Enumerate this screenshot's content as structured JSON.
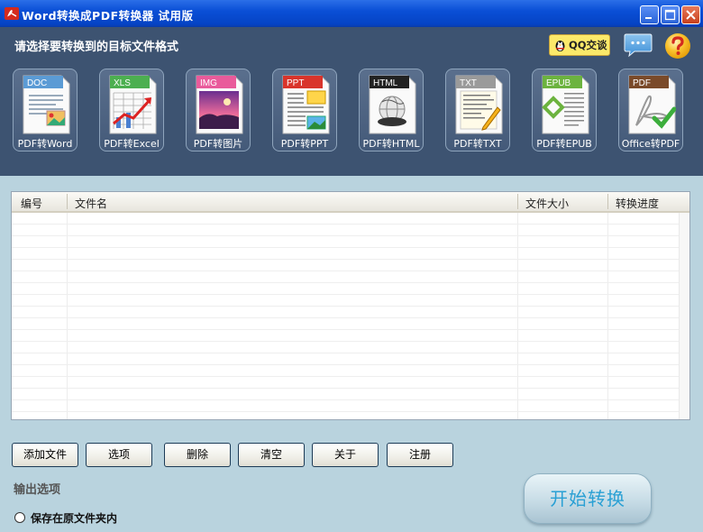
{
  "window": {
    "title": "Word转换成PDF转换器 试用版"
  },
  "header": {
    "prompt": "请选择要转换到的目标文件格式",
    "qq_label": "QQ交谈"
  },
  "formats": [
    {
      "badge": "DOC",
      "label": "PDF转Word",
      "color": "#5b9bd5"
    },
    {
      "badge": "XLS",
      "label": "PDF转Excel",
      "color": "#4caf50"
    },
    {
      "badge": "IMG",
      "label": "PDF转图片",
      "color": "#e95b9b"
    },
    {
      "badge": "PPT",
      "label": "PDF转PPT",
      "color": "#d9342b"
    },
    {
      "badge": "HTML",
      "label": "PDF转HTML",
      "color": "#222222"
    },
    {
      "badge": "TXT",
      "label": "PDF转TXT",
      "color": "#9a9a9a"
    },
    {
      "badge": "EPUB",
      "label": "PDF转EPUB",
      "color": "#6cb33f"
    },
    {
      "badge": "PDF",
      "label": "Office转PDF",
      "color": "#7a4a2a"
    }
  ],
  "table": {
    "columns": [
      "编号",
      "文件名",
      "文件大小",
      "转换进度"
    ],
    "rows": []
  },
  "buttons": {
    "add_file": "添加文件",
    "options": "选项",
    "delete": "删除",
    "clear": "清空",
    "about": "关于",
    "register": "注册"
  },
  "output": {
    "label": "输出选项",
    "radio_label": "保存在原文件夹内",
    "radio_checked": false
  },
  "start_button": "开始转换"
}
